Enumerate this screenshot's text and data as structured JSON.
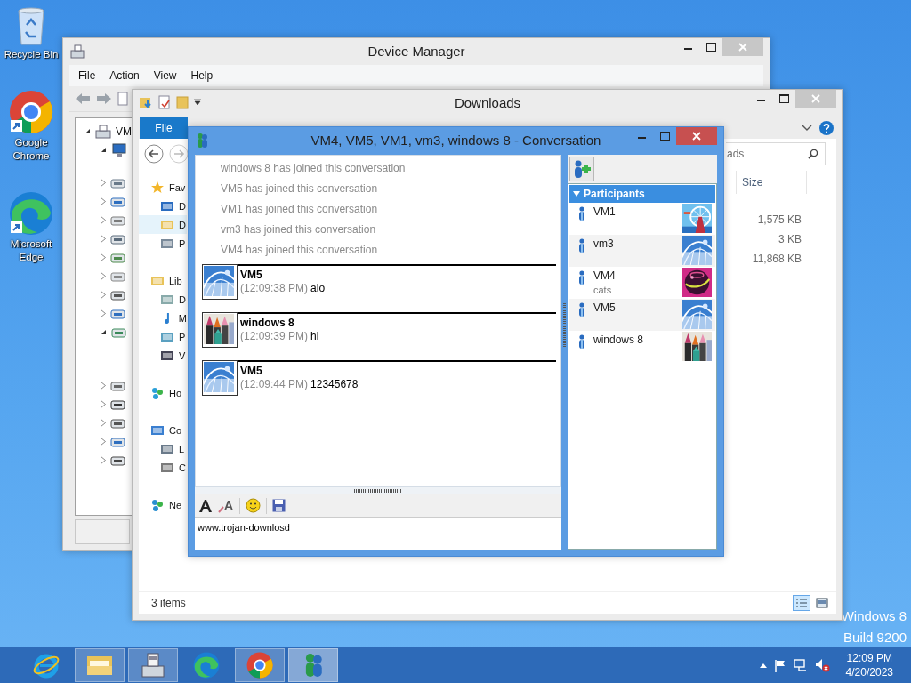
{
  "desktop": {
    "icons": [
      {
        "label": "Recycle Bin",
        "kind": "recycle"
      },
      {
        "label": "Google Chrome",
        "kind": "chrome"
      },
      {
        "label": "Microsoft Edge",
        "kind": "edge"
      }
    ],
    "watermark": [
      "Windows 8",
      "Build 9200"
    ]
  },
  "device_manager": {
    "title": "Device Manager",
    "menu": [
      "File",
      "Action",
      "View",
      "Help"
    ],
    "tree": {
      "label": "VM",
      "expanded": true,
      "computer": {
        "expanded": true
      },
      "devices": [
        {
          "expanded": false
        },
        {
          "expanded": false
        },
        {
          "expanded": false
        },
        {
          "expanded": false
        },
        {
          "expanded": false
        },
        {
          "expanded": false
        },
        {
          "expanded": false
        },
        {
          "expanded": false
        },
        {
          "expanded": true
        },
        {
          "expanded": false
        },
        {
          "expanded": false
        },
        {
          "expanded": false
        },
        {
          "expanded": false
        },
        {
          "expanded": false
        }
      ]
    }
  },
  "downloads": {
    "title": "Downloads",
    "ribbon_tab": "File",
    "search": {
      "placeholder": "ads"
    },
    "nav": [
      {
        "label": "Fav",
        "kind": "star",
        "selected": false,
        "children": [
          {
            "label": "D",
            "kind": "desktop",
            "selected": false
          },
          {
            "label": "D",
            "kind": "downloads",
            "selected": true
          },
          {
            "label": "P",
            "kind": "places",
            "selected": false
          }
        ]
      },
      {
        "label": "Lib",
        "kind": "library",
        "selected": false,
        "children": [
          {
            "label": "D",
            "kind": "documents",
            "selected": false
          },
          {
            "label": "M",
            "kind": "music",
            "selected": false
          },
          {
            "label": "P",
            "kind": "pictures",
            "selected": false
          },
          {
            "label": "V",
            "kind": "videos",
            "selected": false
          }
        ]
      },
      {
        "label": "Ho",
        "kind": "homegroup",
        "selected": false
      },
      {
        "label": "Co",
        "kind": "computer",
        "selected": false,
        "children": [
          {
            "label": "L",
            "kind": "drive",
            "selected": false
          },
          {
            "label": "C",
            "kind": "netdrive",
            "selected": false
          }
        ]
      },
      {
        "label": "Ne",
        "kind": "network",
        "selected": false
      }
    ],
    "columns": [
      {
        "label": "Size"
      }
    ],
    "rows": [
      {
        "size": "1,575 KB"
      },
      {
        "size": "3 KB"
      },
      {
        "size": "11,868 KB"
      }
    ],
    "status": "3 items",
    "views": [
      {
        "kind": "details",
        "selected": true
      },
      {
        "kind": "tiles",
        "selected": false
      }
    ]
  },
  "conversation": {
    "title": "VM4, VM5, VM1, vm3, windows 8 - Conversation",
    "system_messages": [
      "windows 8 has joined this conversation",
      "VM5 has joined this conversation",
      "VM1 has joined this conversation",
      "vm3 has joined this conversation",
      "VM4 has joined this conversation"
    ],
    "messages": [
      {
        "sender": "VM5",
        "time": "(12:09:38 PM)",
        "text": "alo",
        "kind": "coaster"
      },
      {
        "sender": "windows 8",
        "time": "(12:09:39 PM)",
        "text": "hi",
        "kind": "crayons"
      },
      {
        "sender": "VM5",
        "time": "(12:09:44 PM)",
        "text": "12345678",
        "kind": "coaster"
      }
    ],
    "input": {
      "value": "www.trojan-downlosd"
    },
    "participants_header": {
      "label": "Participants",
      "expanded": true
    },
    "participants": [
      {
        "name": "VM1",
        "kind": "wheel"
      },
      {
        "name": "vm3",
        "kind": "coaster"
      },
      {
        "name": "VM4",
        "status": "cats",
        "kind": "ball"
      },
      {
        "name": "VM5",
        "kind": "coaster"
      },
      {
        "name": "windows 8",
        "kind": "crayons"
      }
    ]
  },
  "taskbar": {
    "apps": [
      {
        "kind": "ie",
        "open": false,
        "selected": false
      },
      {
        "kind": "explorer",
        "open": true,
        "selected": false
      },
      {
        "kind": "devices",
        "open": true,
        "selected": false
      },
      {
        "kind": "edge",
        "open": false,
        "selected": false
      },
      {
        "kind": "chrome",
        "open": true,
        "selected": false
      },
      {
        "kind": "messenger",
        "open": true,
        "selected": true
      }
    ],
    "time": "12:09 PM",
    "date": "4/20/2023"
  }
}
